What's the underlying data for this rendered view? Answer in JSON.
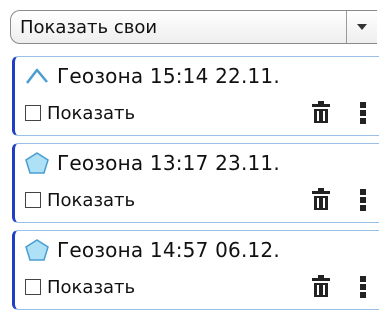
{
  "filter": {
    "selected": "Показать свои"
  },
  "geozones": [
    {
      "icon": "polyline-icon",
      "title": "Геозона 15:14 22.11.",
      "show_label": "Показать",
      "checked": false
    },
    {
      "icon": "polygon-icon",
      "title": "Геозона 13:17 23.11.",
      "show_label": "Показать",
      "checked": false
    },
    {
      "icon": "polygon-icon",
      "title": "Геозона 14:57 06.12.",
      "show_label": "Показать",
      "checked": false
    }
  ],
  "colors": {
    "accent_border": "#1f3fc4",
    "card_border": "#9ac0e8",
    "polygon_fill": "#aee0f6",
    "polygon_stroke": "#4a9dd0"
  }
}
